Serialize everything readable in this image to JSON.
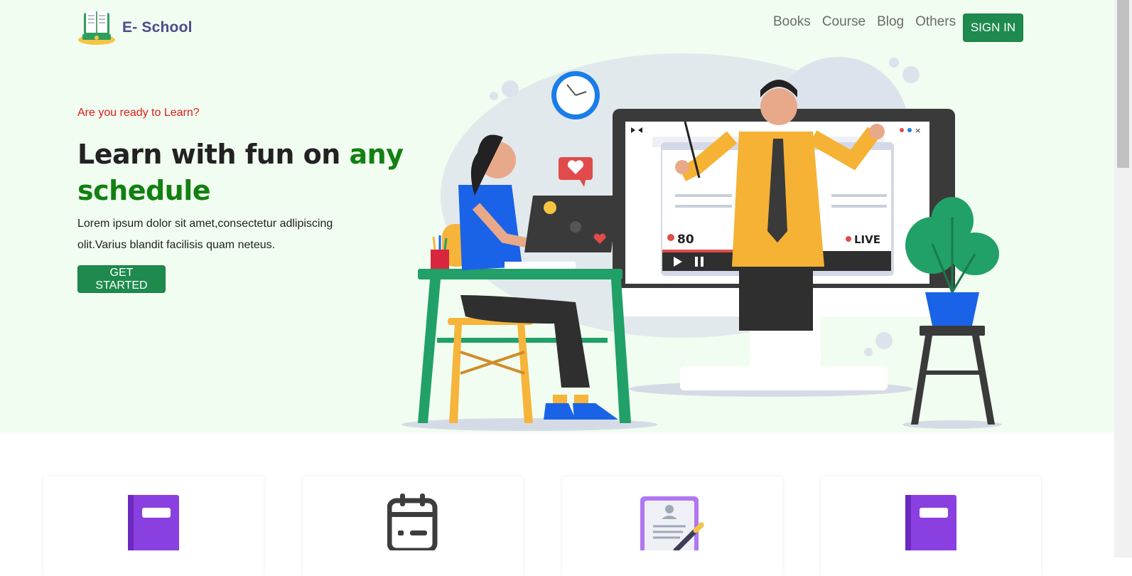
{
  "brand": {
    "name": "E- School",
    "logo_icon": "book-stand-icon"
  },
  "nav": {
    "items": [
      "Books",
      "Course",
      "Blog",
      "Others"
    ],
    "signin_label": "SIGN IN"
  },
  "hero": {
    "tagline": "Are you ready to Learn?",
    "headline_main": "Learn with fun on ",
    "headline_accent": "any schedule",
    "description": "Lorem ipsum dolor sit amet,consectetur adlipiscing olit.Varius blandit facilisis quam neteus.",
    "cta_label": "GET STARTED",
    "illustration": {
      "viewer_count": "80",
      "live_label": "LIVE"
    }
  },
  "features": [
    {
      "icon": "purple-book-icon"
    },
    {
      "icon": "calendar-icon"
    },
    {
      "icon": "document-pen-icon"
    },
    {
      "icon": "purple-book-icon"
    }
  ],
  "colors": {
    "hero_bg": "#f0fdf0",
    "accent_green": "#128012",
    "button_green": "#1e8a4e",
    "tagline_red": "#e01b1b",
    "brand_purple": "#4b4b8f"
  }
}
